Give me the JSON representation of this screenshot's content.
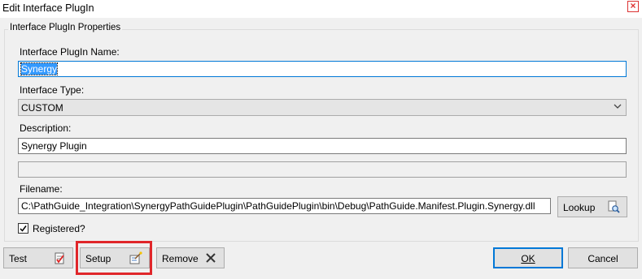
{
  "window": {
    "title": "Edit Interface PlugIn",
    "close_glyph": "×"
  },
  "group": {
    "legend": "Interface PlugIn Properties"
  },
  "fields": {
    "name_label": "Interface PlugIn Name:",
    "name_value": "Synergy",
    "type_label": "Interface Type:",
    "type_value": "CUSTOM",
    "description_label": "Description:",
    "description_value": "Synergy Plugin",
    "extra_value": "",
    "filename_label": "Filename:",
    "filename_value": "C:\\PathGuide_Integration\\SynergyPathGuidePlugin\\PathGuidePlugin\\bin\\Debug\\PathGuide.Manifest.Plugin.Synergy.dll",
    "registered_label": "Registered?",
    "registered_checked": true
  },
  "buttons": {
    "lookup": "Lookup",
    "test": "Test",
    "setup": "Setup",
    "remove": "Remove",
    "ok": "OK",
    "cancel": "Cancel"
  },
  "colors": {
    "highlight": "#e0262a",
    "selection": "#3399ff",
    "focus": "#0078d7"
  }
}
